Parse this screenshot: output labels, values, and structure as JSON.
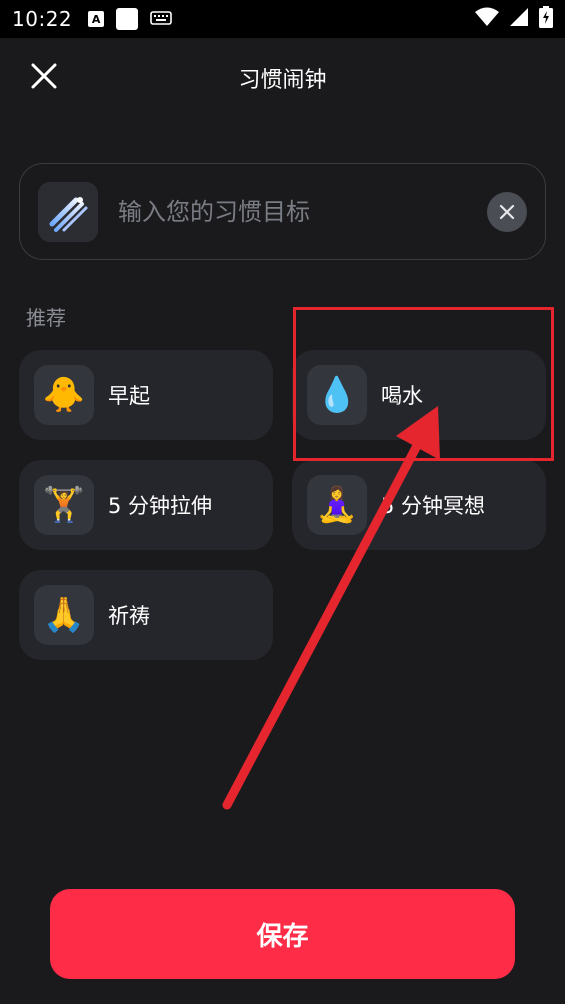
{
  "status_bar": {
    "time": "10:22",
    "a_icon_text": "A",
    "icons": [
      "a-icon",
      "square-icon",
      "keyboard-icon",
      "wifi-icon",
      "signal-icon",
      "battery-icon"
    ]
  },
  "header": {
    "title": "习惯闹钟",
    "close_icon": "close-icon"
  },
  "habit_input": {
    "placeholder": "输入您的习惯目标",
    "value": "",
    "icon": "meteor-icon",
    "clear_icon": "clear-icon"
  },
  "recommend": {
    "label": "推荐",
    "items": [
      {
        "label": "早起",
        "icon": "🐥",
        "icon_name": "chick-icon"
      },
      {
        "label": "喝水",
        "icon": "💧",
        "icon_name": "water-drop-icon"
      },
      {
        "label": "5 分钟拉伸",
        "icon": "🏋️",
        "icon_name": "weightlifter-icon"
      },
      {
        "label": "5 分钟冥想",
        "icon": "🧘‍♀️",
        "icon_name": "meditation-icon"
      },
      {
        "label": "祈祷",
        "icon": "🙏",
        "icon_name": "praying-hands-icon"
      }
    ]
  },
  "annotation": {
    "highlight_color": "#e5262e",
    "arrow_color": "#e5262e"
  },
  "save_button": {
    "label": "保存",
    "color": "#fe2c47"
  }
}
